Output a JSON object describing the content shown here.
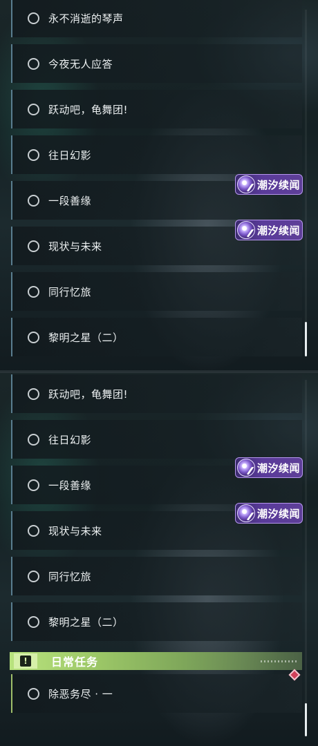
{
  "top_panel": {
    "quests": [
      {
        "title": "永不消逝的琴声"
      },
      {
        "title": "今夜无人应答"
      },
      {
        "title": "跃动吧，龟舞团!"
      },
      {
        "title": "往日幻影"
      },
      {
        "title": "一段善缘"
      },
      {
        "title": "现状与未来"
      },
      {
        "title": "同行忆旅"
      },
      {
        "title": "黎明之星（二）"
      }
    ],
    "badges": [
      {
        "label": "潮汐续闻",
        "icon": "tidal-story-icon"
      },
      {
        "label": "潮汐续闻",
        "icon": "tidal-story-icon"
      }
    ]
  },
  "bottom_panel": {
    "quests": [
      {
        "title": "跃动吧，龟舞团!"
      },
      {
        "title": "往日幻影"
      },
      {
        "title": "一段善缘"
      },
      {
        "title": "现状与未来"
      },
      {
        "title": "同行忆旅"
      },
      {
        "title": "黎明之星（二）"
      }
    ],
    "badges": [
      {
        "label": "潮汐续闻",
        "icon": "tidal-story-icon"
      },
      {
        "label": "潮汐续闻",
        "icon": "tidal-story-icon"
      }
    ],
    "daily_section": {
      "title": "日常任务",
      "icon": "exclamation-icon",
      "quests": [
        {
          "title": "除恶务尽 · 一"
        }
      ]
    }
  },
  "colors": {
    "row_accent": "#5a7e90",
    "daily_accent": "#9fbf6a",
    "badge_purple": "#5a3b9a",
    "badge_border": "#b696ee",
    "daily_header": "#9cc767",
    "marker_red": "#d0405a"
  }
}
